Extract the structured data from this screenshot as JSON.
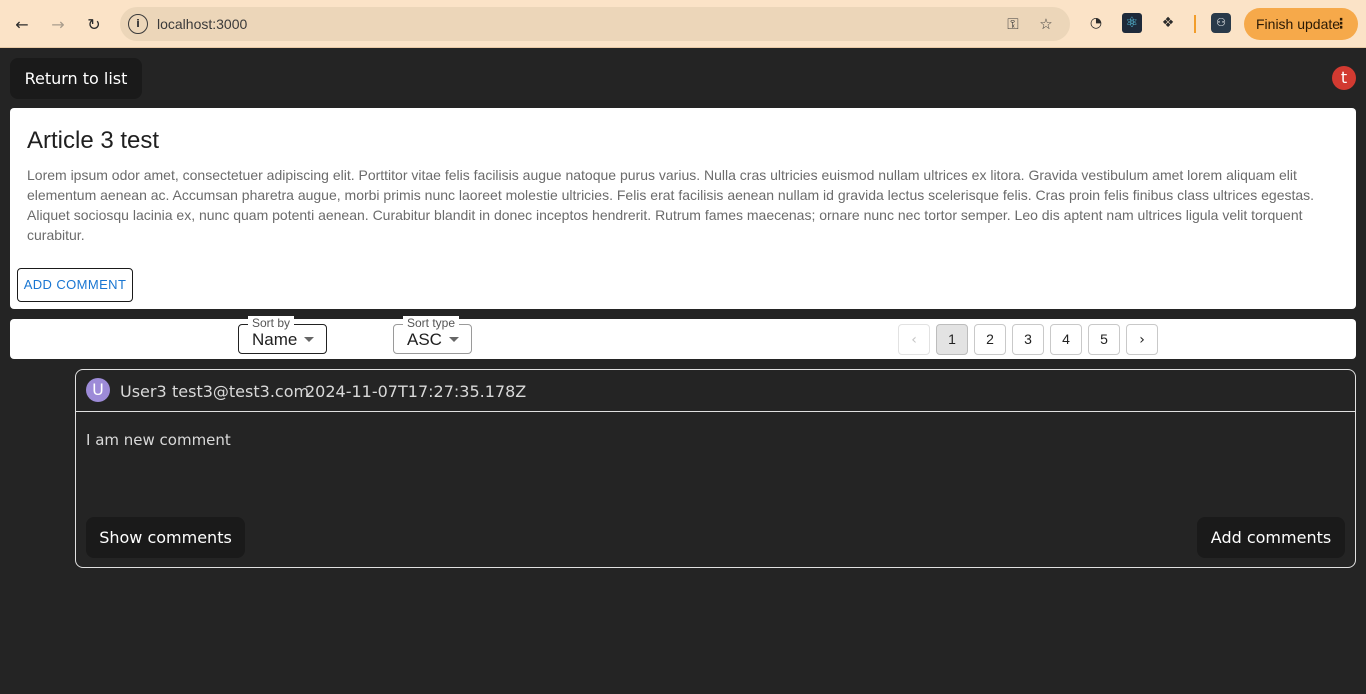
{
  "browser": {
    "url": "localhost:3000",
    "finish_update": "Finish update"
  },
  "page": {
    "return_label": "Return to list",
    "user_initial": "t"
  },
  "article": {
    "title": "Article 3 test",
    "body": "Lorem ipsum odor amet, consectetuer adipiscing elit. Porttitor vitae felis facilisis augue natoque purus varius. Nulla cras ultricies euismod nullam ultrices ex litora. Gravida vestibulum amet lorem aliquam elit elementum aenean ac. Accumsan pharetra augue, morbi primis nunc laoreet molestie ultricies. Felis erat facilisis aenean nullam id gravida lectus scelerisque felis. Cras proin felis finibus class ultrices egestas. Aliquet sociosqu lacinia ex, nunc quam potenti aenean. Curabitur blandit in donec inceptos hendrerit. Rutrum fames maecenas; ornare nunc nec tortor semper. Leo dis aptent nam ultrices ligula velit torquent curabitur.",
    "add_comment_label": "ADD COMMENT"
  },
  "toolbar": {
    "sort_by": {
      "label": "Sort by",
      "value": "Name"
    },
    "sort_type": {
      "label": "Sort type",
      "value": "ASC"
    },
    "pagination": {
      "pages": [
        "1",
        "2",
        "3",
        "4",
        "5"
      ],
      "current": "1"
    }
  },
  "comment": {
    "avatar_initial": "U",
    "author": "User3",
    "email": "test3@test3.com",
    "timestamp": "2024-11-07T17:27:35.178Z",
    "text": "I am new comment",
    "show_comments_label": "Show comments",
    "add_comments_label": "Add comments"
  },
  "colors": {
    "chrome_bg": "#fbe3c7",
    "page_bg": "#242424",
    "finish_update_bg": "#f6a94a",
    "link_blue": "#1976d2",
    "user_avatar": "#d23a31",
    "comment_avatar": "#9d8bd8"
  }
}
